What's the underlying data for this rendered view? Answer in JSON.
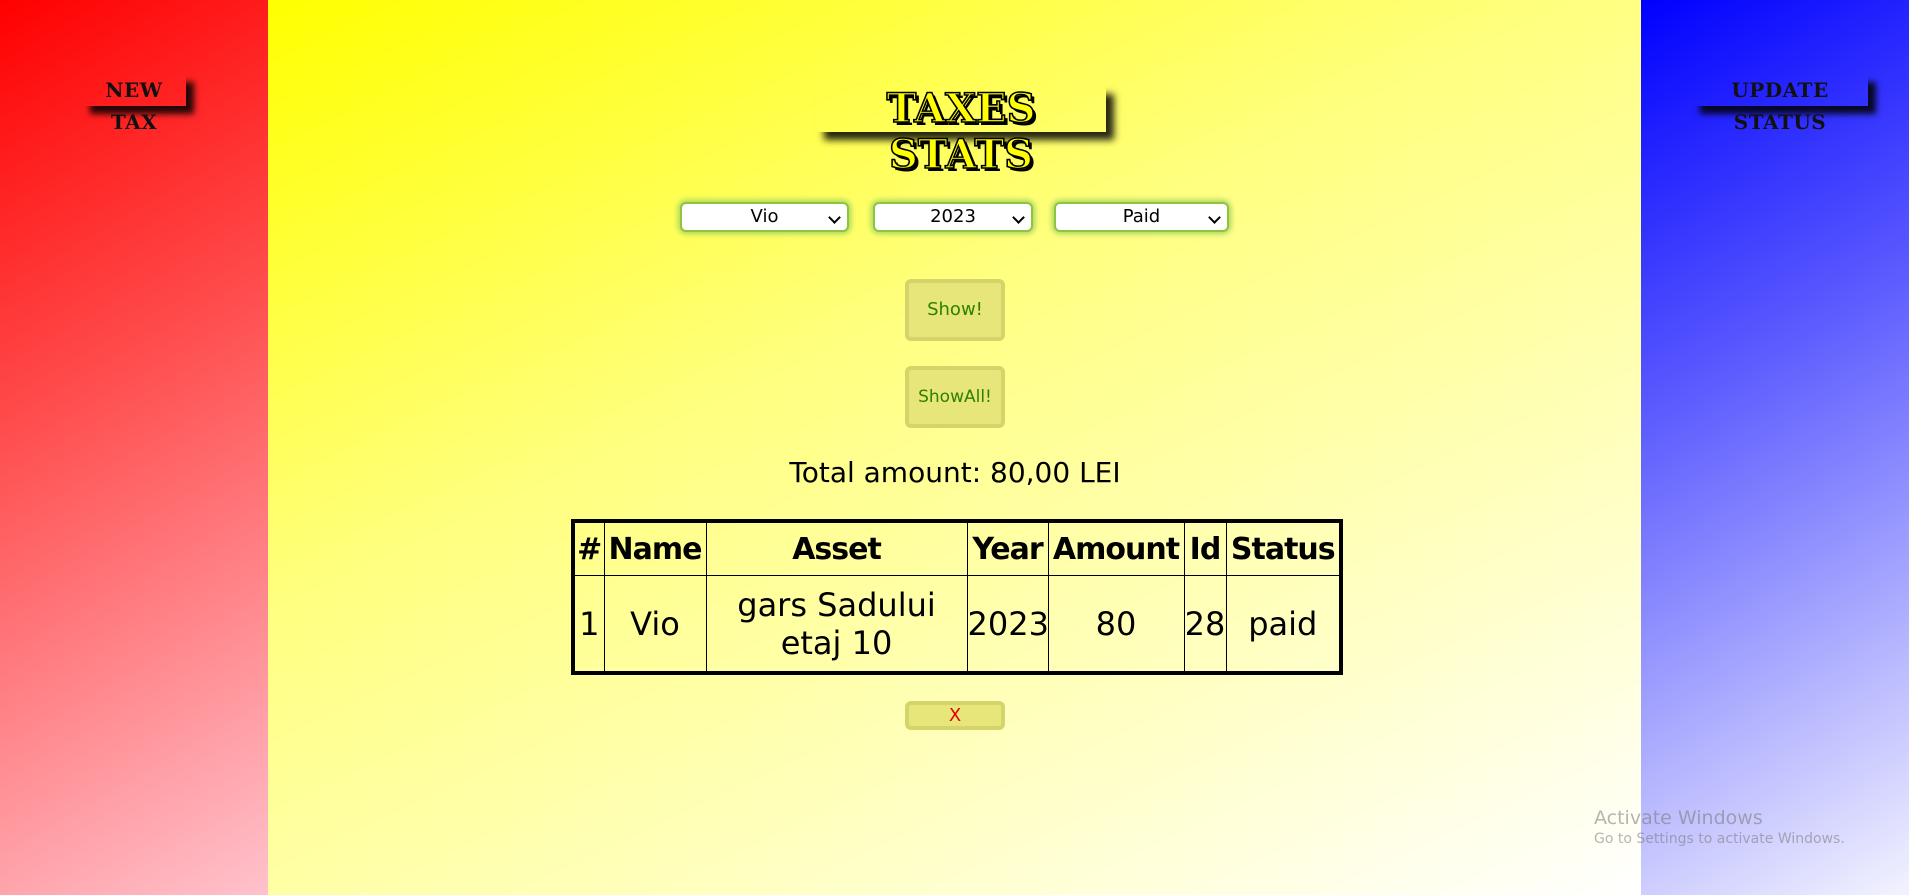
{
  "nav": {
    "new_tax": "NEW TAX",
    "update_status": "UPDATE STATUS"
  },
  "page": {
    "title": "TAXES STATS"
  },
  "filters": {
    "owner": "Vio",
    "year": "2023",
    "status": "Paid"
  },
  "buttons": {
    "show": "Show!",
    "show_all": "ShowAll!",
    "close": "X"
  },
  "total": {
    "label": "Total amount: 80,00 LEI"
  },
  "table": {
    "headers": [
      "#",
      "Name",
      "Asset",
      "Year",
      "Amount",
      "Id",
      "Status"
    ],
    "rows": [
      [
        "1",
        "Vio",
        "gars Sadului etaj 10",
        "2023",
        "80",
        "28",
        "paid"
      ]
    ]
  },
  "watermark": {
    "line1": "Activate Windows",
    "line2": "Go to Settings to activate Windows."
  },
  "colors": {
    "left_panel": "#ff0000",
    "right_panel": "#0000ff",
    "main_background": "#ffff00",
    "button_text": "#2f7f00",
    "close_text": "#e00000",
    "select_glow": "#a7d462"
  }
}
